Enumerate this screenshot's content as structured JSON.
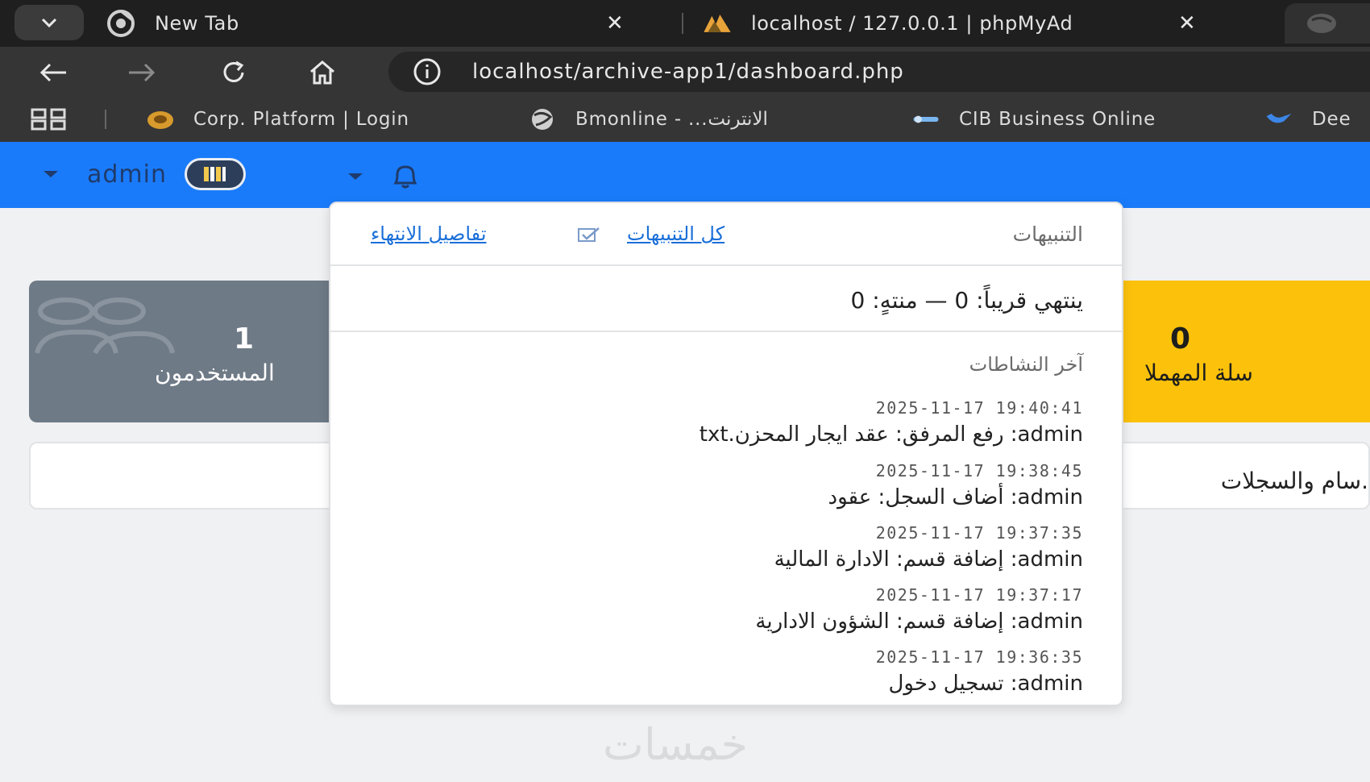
{
  "browser": {
    "tabs": [
      {
        "title": "New Tab",
        "favicon": "chrome-icon"
      },
      {
        "title": "localhost / 127.0.0.1 | phpMyAd",
        "favicon": "phpmyadmin-icon"
      }
    ],
    "url": "localhost/archive-app1/dashboard.php",
    "bookmarks": [
      {
        "label": "Corp. Platform | Login",
        "icon": "corp-icon"
      },
      {
        "label": "Bmonline - ...الانترنت",
        "icon": "globe-icon"
      },
      {
        "label": "CIB Business Online",
        "icon": "cib-icon"
      },
      {
        "label": "Dee",
        "icon": "bird-icon"
      }
    ]
  },
  "navbar": {
    "username": "admin",
    "accent": "#1a7bfa"
  },
  "cards": {
    "users": {
      "count": "1",
      "label": "المستخدمون"
    },
    "trash": {
      "count": "0",
      "label": "سلة المهملا"
    }
  },
  "panel": {
    "text": "سام والسجلات."
  },
  "notifications": {
    "title": "التنبيهات",
    "all_link": "كل التنبيهات",
    "details_link": "تفاصيل الانتهاء",
    "summary": "ينتهي قريباً: 0 — منتهٍ: 0",
    "activity_title": "آخر النشاطات",
    "activities": [
      {
        "time": "2025-11-17 19:40:41",
        "text": "admin: رفع المرفق: عقد ايجار المحزن.txt"
      },
      {
        "time": "2025-11-17 19:38:45",
        "text": "admin: أضاف السجل: عقود"
      },
      {
        "time": "2025-11-17 19:37:35",
        "text": "admin: إضافة قسم: الادارة المالية"
      },
      {
        "time": "2025-11-17 19:37:17",
        "text": "admin: إضافة قسم: الشؤون الادارية"
      },
      {
        "time": "2025-11-17 19:36:35",
        "text": "admin: تسجيل دخول"
      }
    ]
  },
  "watermark": "خمسات"
}
